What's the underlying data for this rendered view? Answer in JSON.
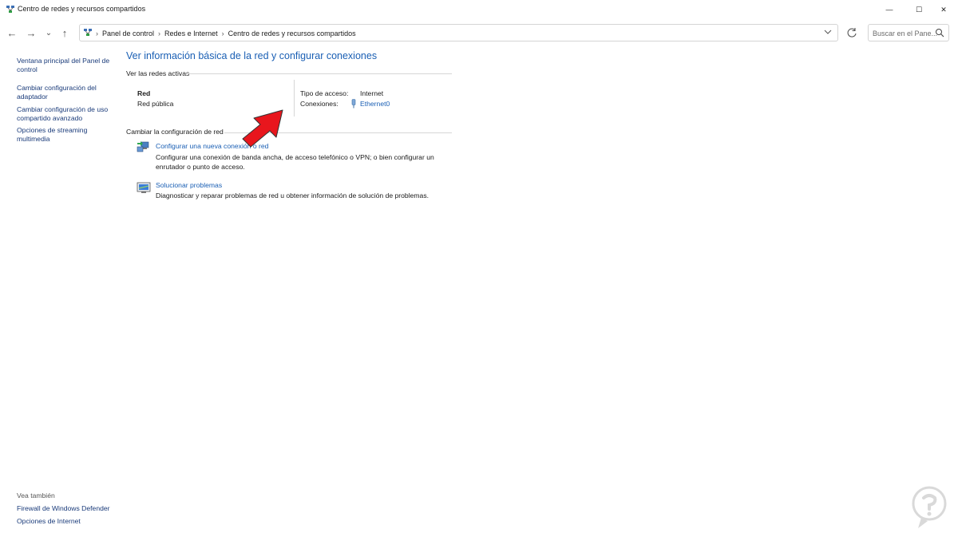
{
  "window": {
    "title": "Centro de redes y recursos compartidos",
    "controls": {
      "minimize": "—",
      "maximize": "☐",
      "close": "✕"
    }
  },
  "nav": {
    "back_icon": "←",
    "forward_icon": "→",
    "recent_icon": "⌄",
    "up_icon": "↑",
    "breadcrumbs": [
      "Panel de control",
      "Redes e Internet",
      "Centro de redes y recursos compartidos"
    ],
    "breadcrumb_separator": "›",
    "search_placeholder": "Buscar en el Pane..."
  },
  "sidebar": {
    "links": [
      "Ventana principal del Panel de control",
      "Cambiar configuración del adaptador",
      "Cambiar configuración de uso compartido avanzado",
      "Opciones de streaming multimedia"
    ],
    "see_also_label": "Vea también",
    "see_also_links": [
      "Firewall de Windows Defender",
      "Opciones de Internet"
    ]
  },
  "main": {
    "title": "Ver información básica de la red y configurar conexiones",
    "active_networks_label": "Ver las redes activas",
    "network": {
      "name": "Red",
      "type": "Red pública",
      "access_type_label": "Tipo de acceso:",
      "access_type_value": "Internet",
      "connections_label": "Conexiones:",
      "connections_value": "Ethernet0"
    },
    "change_settings_label": "Cambiar la configuración de red",
    "tasks": [
      {
        "title": "Configurar una nueva conexión o red",
        "description": "Configurar una conexión de banda ancha, de acceso telefónico o VPN; o bien configurar un enrutador o punto de acceso.",
        "icon": "network-setup-icon"
      },
      {
        "title": "Solucionar problemas",
        "description": "Diagnosticar y reparar problemas de red u obtener información de solución de problemas.",
        "icon": "troubleshoot-icon"
      }
    ]
  },
  "colors": {
    "link": "#1a5fb4",
    "sidebar_link": "#1a3b7a",
    "arrow": "#e8161d"
  }
}
